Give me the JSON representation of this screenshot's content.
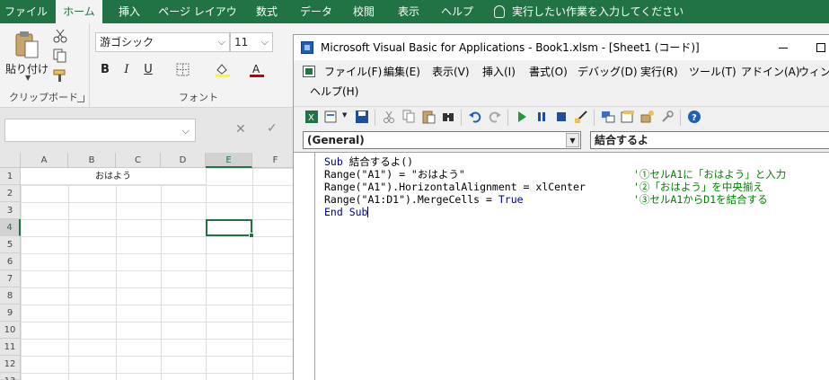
{
  "excel": {
    "tabs": [
      "ファイル",
      "ホーム",
      "挿入",
      "ページ レイアウト",
      "数式",
      "データ",
      "校閲",
      "表示",
      "ヘルプ"
    ],
    "active_tab": "ホーム",
    "tell_me": "実行したい作業を入力してください",
    "clipboard": {
      "paste_label": "貼り付け",
      "group_label": "クリップボード"
    },
    "font": {
      "name": "游ゴシック",
      "size": "11",
      "group_label": "フォント",
      "bold": "B",
      "italic": "I",
      "underline": "U"
    },
    "formula_bar": {
      "cancel": "✕",
      "enter": "✓"
    },
    "columns": [
      "A",
      "B",
      "C",
      "D",
      "E",
      "F"
    ],
    "selected_column": "E",
    "rows": [
      "1",
      "2",
      "3",
      "4",
      "5",
      "6",
      "7",
      "8",
      "9",
      "10",
      "11",
      "12",
      "13"
    ],
    "selected_row": "4",
    "merged_cell_text": "おはよう"
  },
  "vbe": {
    "title": "Microsoft Visual Basic for Applications - Book1.xlsm - [Sheet1 (コード)]",
    "menu_row1": [
      "ファイル(F)",
      "編集(E)",
      "表示(V)",
      "挿入(I)",
      "書式(O)",
      "デバッグ(D)",
      "実行(R)",
      "ツール(T)",
      "アドイン(A)",
      "ウィンド"
    ],
    "menu_row2": [
      "ヘルプ(H)"
    ],
    "object_combo": "(General)",
    "procedure_combo": "結合するよ",
    "code": {
      "sub_kw": "Sub",
      "sub_name": "結合するよ()",
      "line1": "Range(\"A1\") = \"おはよう\"",
      "comment1": "'①セルA1に「おはよう」と入力",
      "line2": "Range(\"A1\").HorizontalAlignment = xlCenter",
      "comment2": "'②「おはよう」を中央揃え",
      "line3_a": "Range(\"A1:D1\").MergeCells = ",
      "line3_kw": "True",
      "comment3": "'③セルA1からD1を結合する",
      "end_kw": "End Sub"
    }
  }
}
